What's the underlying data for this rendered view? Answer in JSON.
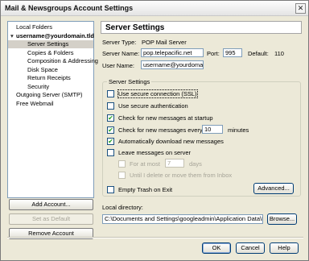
{
  "window": {
    "title": "Mail & Newsgroups Account Settings",
    "close_glyph": "✕"
  },
  "tree": {
    "items": [
      {
        "label": "Local Folders",
        "indent": 0,
        "bold": false,
        "twisty": ""
      },
      {
        "label": "username@yourdomain.tld",
        "indent": 0,
        "bold": true,
        "twisty": "▾"
      },
      {
        "label": "Server Settings",
        "indent": 1,
        "bold": false,
        "twisty": "",
        "selected": true
      },
      {
        "label": "Copies & Folders",
        "indent": 1,
        "bold": false,
        "twisty": ""
      },
      {
        "label": "Composition & Addressing",
        "indent": 1,
        "bold": false,
        "twisty": ""
      },
      {
        "label": "Disk Space",
        "indent": 1,
        "bold": false,
        "twisty": ""
      },
      {
        "label": "Return Receipts",
        "indent": 1,
        "bold": false,
        "twisty": ""
      },
      {
        "label": "Security",
        "indent": 1,
        "bold": false,
        "twisty": ""
      },
      {
        "label": "Outgoing Server (SMTP)",
        "indent": 0,
        "bold": false,
        "twisty": ""
      },
      {
        "label": "Free Webmail",
        "indent": 0,
        "bold": false,
        "twisty": ""
      }
    ]
  },
  "side_buttons": {
    "add_account": "Add Account...",
    "set_default": "Set as Default",
    "remove_account": "Remove Account"
  },
  "panel": {
    "header": "Server Settings",
    "server_type_label": "Server Type:",
    "server_type_value": "POP Mail Server",
    "server_name_label": "Server Name:",
    "server_name_value": "pop.telepacific.net",
    "port_label": "Port:",
    "port_value": "995",
    "default_label": "Default:",
    "default_value": "110",
    "user_name_label": "User Name:",
    "user_name_value": "username@yourdomain."
  },
  "server_settings": {
    "group_title": "Server Settings",
    "use_ssl": {
      "label": "Use secure connection (SSL)",
      "checked": false
    },
    "secure_auth": {
      "label": "Use secure authentication",
      "checked": false
    },
    "check_startup": {
      "label": "Check for new messages at startup",
      "checked": true
    },
    "check_every": {
      "label": "Check for new messages every",
      "checked": true,
      "value": "10",
      "unit": "minutes"
    },
    "auto_download": {
      "label": "Automatically download new messages",
      "checked": true
    },
    "leave_on_server": {
      "label": "Leave messages on server",
      "checked": false
    },
    "for_at_most": {
      "label": "For at most",
      "value": "7",
      "unit": "days",
      "checked": false
    },
    "until_delete": {
      "label": "Until I delete or move them from Inbox",
      "checked": false
    },
    "empty_trash": {
      "label": "Empty Trash on Exit",
      "checked": false
    },
    "advanced_button": "Advanced..."
  },
  "local_directory": {
    "label": "Local directory:",
    "value": "C:\\Documents and Settings\\googleadmin\\Application Data\\Mozill",
    "browse_button": "Browse..."
  },
  "dialog_buttons": {
    "ok": "OK",
    "cancel": "Cancel",
    "help": "Help"
  },
  "check_glyph": "✔"
}
